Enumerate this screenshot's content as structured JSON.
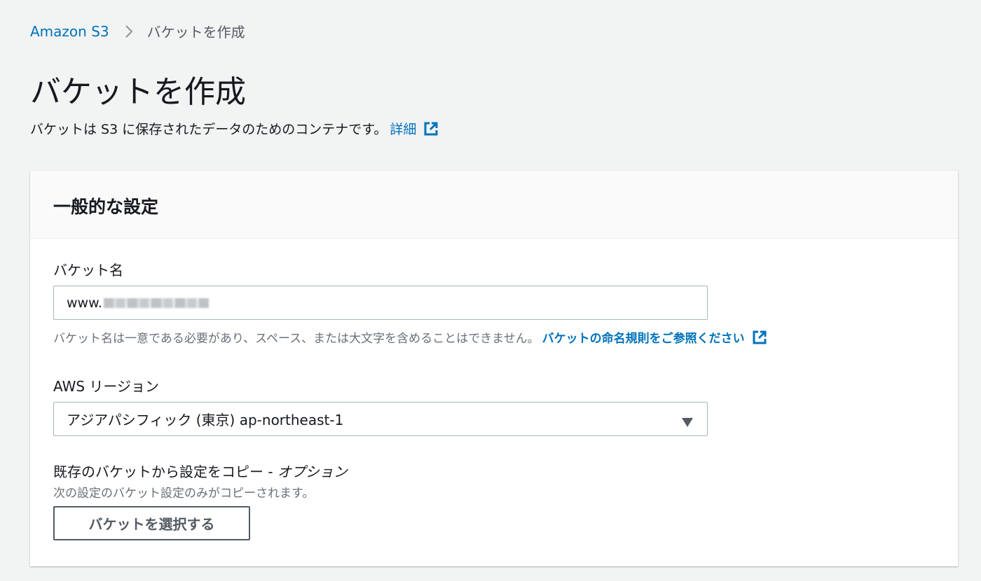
{
  "breadcrumb": {
    "root": "Amazon S3",
    "current": "バケットを作成"
  },
  "page": {
    "title": "バケットを作成",
    "description": "バケットは S3 に保存されたデータのためのコンテナです。",
    "info_link": "詳細"
  },
  "panel": {
    "title": "一般的な設定",
    "bucket_name": {
      "label": "バケット名",
      "value": "www.",
      "hint": "バケット名は一意である必要があり、スペース、または大文字を含めることはできません。",
      "hint_link": "バケットの命名規則をご参照ください"
    },
    "region": {
      "label": "AWS リージョン",
      "selected": "アジアパシフィック (東京) ap-northeast-1"
    },
    "copy_settings": {
      "label": "既存のバケットから設定をコピー - ",
      "label_optional": "オプション",
      "description": "次の設定のバケット設定のみがコピーされます。",
      "button": "バケットを選択する"
    }
  },
  "colors": {
    "link": "#0073bb",
    "background": "#f2f3f3",
    "text": "#16191f",
    "muted": "#687078"
  },
  "icons": [
    "chevron-right-icon",
    "external-link-icon",
    "caret-down-icon"
  ]
}
